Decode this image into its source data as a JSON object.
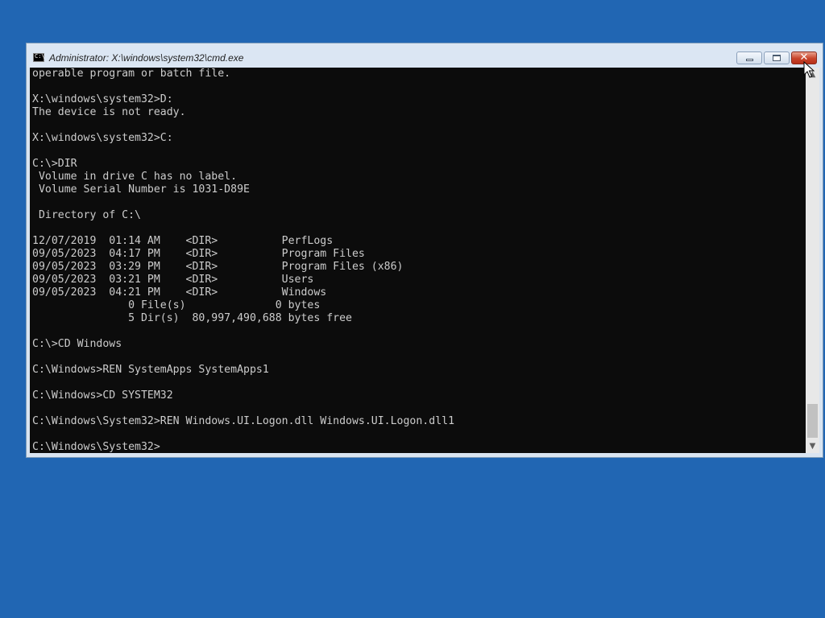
{
  "window": {
    "title": "Administrator: X:\\windows\\system32\\cmd.exe",
    "icon": "cmd-icon",
    "buttons": {
      "minimize": "minimize-icon",
      "maximize": "maximize-icon",
      "close": "close-icon"
    }
  },
  "console": {
    "lines": [
      "operable program or batch file.",
      "",
      "X:\\windows\\system32>D:",
      "The device is not ready.",
      "",
      "X:\\windows\\system32>C:",
      "",
      "C:\\>DIR",
      " Volume in drive C has no label.",
      " Volume Serial Number is 1031-D89E",
      "",
      " Directory of C:\\",
      "",
      "12/07/2019  01:14 AM    <DIR>          PerfLogs",
      "09/05/2023  04:17 PM    <DIR>          Program Files",
      "09/05/2023  03:29 PM    <DIR>          Program Files (x86)",
      "09/05/2023  03:21 PM    <DIR>          Users",
      "09/05/2023  04:21 PM    <DIR>          Windows",
      "               0 File(s)              0 bytes",
      "               5 Dir(s)  80,997,490,688 bytes free",
      "",
      "C:\\>CD Windows",
      "",
      "C:\\Windows>REN SystemApps SystemApps1",
      "",
      "C:\\Windows>CD SYSTEM32",
      "",
      "C:\\Windows\\System32>REN Windows.UI.Logon.dll Windows.UI.Logon.dll1",
      "",
      "C:\\Windows\\System32>"
    ]
  },
  "colors": {
    "desktop": "#2166b3",
    "console_background": "#0c0c0c",
    "console_text": "#cccccc",
    "close_button": "#c8432a"
  }
}
